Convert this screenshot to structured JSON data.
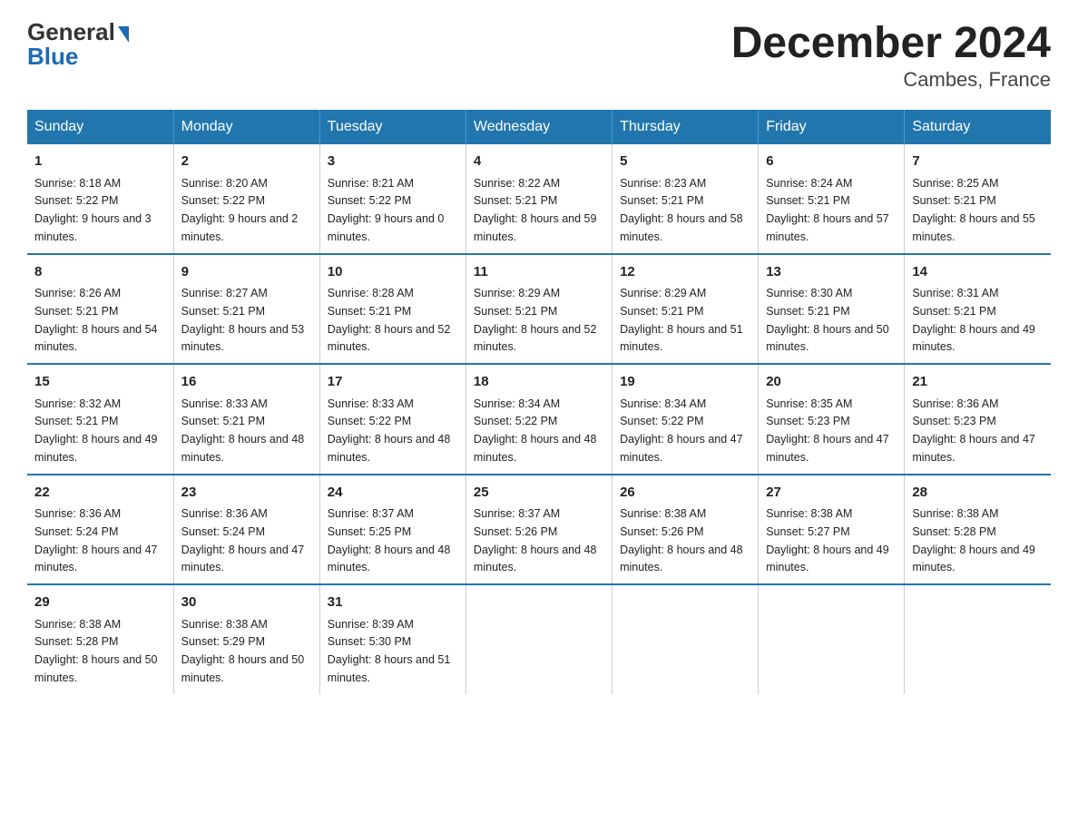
{
  "logo": {
    "general": "General",
    "blue": "Blue",
    "triangle": "▶"
  },
  "title": "December 2024",
  "subtitle": "Cambes, France",
  "days_of_week": [
    "Sunday",
    "Monday",
    "Tuesday",
    "Wednesday",
    "Thursday",
    "Friday",
    "Saturday"
  ],
  "weeks": [
    [
      {
        "day": "1",
        "sunrise": "8:18 AM",
        "sunset": "5:22 PM",
        "daylight": "9 hours and 3 minutes."
      },
      {
        "day": "2",
        "sunrise": "8:20 AM",
        "sunset": "5:22 PM",
        "daylight": "9 hours and 2 minutes."
      },
      {
        "day": "3",
        "sunrise": "8:21 AM",
        "sunset": "5:22 PM",
        "daylight": "9 hours and 0 minutes."
      },
      {
        "day": "4",
        "sunrise": "8:22 AM",
        "sunset": "5:21 PM",
        "daylight": "8 hours and 59 minutes."
      },
      {
        "day": "5",
        "sunrise": "8:23 AM",
        "sunset": "5:21 PM",
        "daylight": "8 hours and 58 minutes."
      },
      {
        "day": "6",
        "sunrise": "8:24 AM",
        "sunset": "5:21 PM",
        "daylight": "8 hours and 57 minutes."
      },
      {
        "day": "7",
        "sunrise": "8:25 AM",
        "sunset": "5:21 PM",
        "daylight": "8 hours and 55 minutes."
      }
    ],
    [
      {
        "day": "8",
        "sunrise": "8:26 AM",
        "sunset": "5:21 PM",
        "daylight": "8 hours and 54 minutes."
      },
      {
        "day": "9",
        "sunrise": "8:27 AM",
        "sunset": "5:21 PM",
        "daylight": "8 hours and 53 minutes."
      },
      {
        "day": "10",
        "sunrise": "8:28 AM",
        "sunset": "5:21 PM",
        "daylight": "8 hours and 52 minutes."
      },
      {
        "day": "11",
        "sunrise": "8:29 AM",
        "sunset": "5:21 PM",
        "daylight": "8 hours and 52 minutes."
      },
      {
        "day": "12",
        "sunrise": "8:29 AM",
        "sunset": "5:21 PM",
        "daylight": "8 hours and 51 minutes."
      },
      {
        "day": "13",
        "sunrise": "8:30 AM",
        "sunset": "5:21 PM",
        "daylight": "8 hours and 50 minutes."
      },
      {
        "day": "14",
        "sunrise": "8:31 AM",
        "sunset": "5:21 PM",
        "daylight": "8 hours and 49 minutes."
      }
    ],
    [
      {
        "day": "15",
        "sunrise": "8:32 AM",
        "sunset": "5:21 PM",
        "daylight": "8 hours and 49 minutes."
      },
      {
        "day": "16",
        "sunrise": "8:33 AM",
        "sunset": "5:21 PM",
        "daylight": "8 hours and 48 minutes."
      },
      {
        "day": "17",
        "sunrise": "8:33 AM",
        "sunset": "5:22 PM",
        "daylight": "8 hours and 48 minutes."
      },
      {
        "day": "18",
        "sunrise": "8:34 AM",
        "sunset": "5:22 PM",
        "daylight": "8 hours and 48 minutes."
      },
      {
        "day": "19",
        "sunrise": "8:34 AM",
        "sunset": "5:22 PM",
        "daylight": "8 hours and 47 minutes."
      },
      {
        "day": "20",
        "sunrise": "8:35 AM",
        "sunset": "5:23 PM",
        "daylight": "8 hours and 47 minutes."
      },
      {
        "day": "21",
        "sunrise": "8:36 AM",
        "sunset": "5:23 PM",
        "daylight": "8 hours and 47 minutes."
      }
    ],
    [
      {
        "day": "22",
        "sunrise": "8:36 AM",
        "sunset": "5:24 PM",
        "daylight": "8 hours and 47 minutes."
      },
      {
        "day": "23",
        "sunrise": "8:36 AM",
        "sunset": "5:24 PM",
        "daylight": "8 hours and 47 minutes."
      },
      {
        "day": "24",
        "sunrise": "8:37 AM",
        "sunset": "5:25 PM",
        "daylight": "8 hours and 48 minutes."
      },
      {
        "day": "25",
        "sunrise": "8:37 AM",
        "sunset": "5:26 PM",
        "daylight": "8 hours and 48 minutes."
      },
      {
        "day": "26",
        "sunrise": "8:38 AM",
        "sunset": "5:26 PM",
        "daylight": "8 hours and 48 minutes."
      },
      {
        "day": "27",
        "sunrise": "8:38 AM",
        "sunset": "5:27 PM",
        "daylight": "8 hours and 49 minutes."
      },
      {
        "day": "28",
        "sunrise": "8:38 AM",
        "sunset": "5:28 PM",
        "daylight": "8 hours and 49 minutes."
      }
    ],
    [
      {
        "day": "29",
        "sunrise": "8:38 AM",
        "sunset": "5:28 PM",
        "daylight": "8 hours and 50 minutes."
      },
      {
        "day": "30",
        "sunrise": "8:38 AM",
        "sunset": "5:29 PM",
        "daylight": "8 hours and 50 minutes."
      },
      {
        "day": "31",
        "sunrise": "8:39 AM",
        "sunset": "5:30 PM",
        "daylight": "8 hours and 51 minutes."
      },
      null,
      null,
      null,
      null
    ]
  ],
  "labels": {
    "sunrise": "Sunrise:",
    "sunset": "Sunset:",
    "daylight": "Daylight:"
  }
}
